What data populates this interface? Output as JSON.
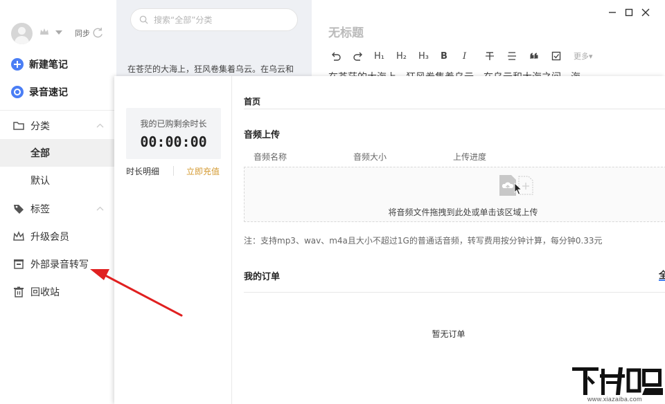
{
  "sidebar": {
    "sync_label": "同步",
    "new_note": "新建笔记",
    "voice_note": "录音速记",
    "nav": {
      "category": "分类",
      "all": "全部",
      "default": "默认",
      "tags": "标签",
      "upgrade": "升级会员",
      "external_transcribe": "外部录音转写",
      "trash": "回收站"
    },
    "accent_color": "#4a7ef5"
  },
  "note_list": {
    "search_placeholder": "搜索“全部”分类",
    "snippet": "在苍茫的大海上，狂风卷集着乌云。在乌云和"
  },
  "editor": {
    "title_placeholder": "无标题",
    "toolbar": [
      "undo",
      "redo",
      "H1",
      "H2",
      "H3",
      "B",
      "I",
      "strikethrough",
      "align",
      "quote",
      "checkbox"
    ],
    "toolbar_labels": {
      "h1": "H₁",
      "h2": "H₂",
      "h3": "H₃",
      "bold": "B",
      "italic": "I",
      "more": "更多"
    },
    "body_text": "在苍茫的大海上，狂风卷集着乌云。在乌云和大海之间，海"
  },
  "transcribe_panel": {
    "remaining_label": "我的已购剩余时长",
    "remaining_value": "00:00:00",
    "duration_detail": "时长明细",
    "recharge": "立即充值",
    "recharge_color": "#d49a32",
    "breadcrumb": "首页",
    "upload_title": "音频上传",
    "columns": [
      "音频名称",
      "音频大小",
      "上传进度"
    ],
    "drop_hint": "将音频文件拖拽到此处或单击该区域上传",
    "note": "注：支持mp3、wav、m4a且大小不超过1G的普通话音频，转写费用按分钟计算，每分钟0.33元",
    "orders_title": "我的订单",
    "orders_tab": "全",
    "orders_empty": "暂无订单"
  },
  "watermark": {
    "logo_text": "下载吧",
    "url": "www.xiazaiba.com"
  }
}
